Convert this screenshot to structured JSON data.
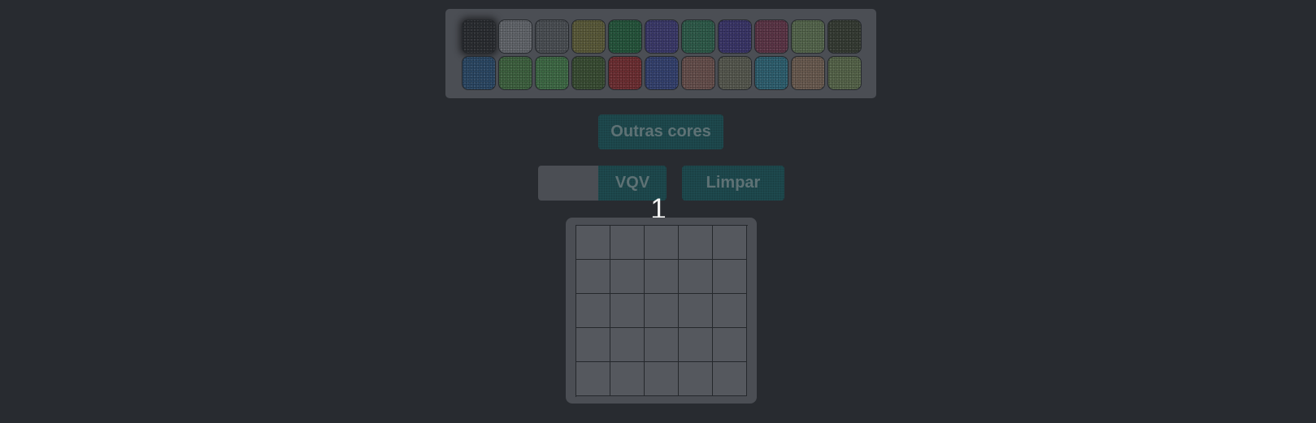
{
  "palette": {
    "rows": [
      [
        {
          "name": "swatch-black",
          "color": "#2a2d31",
          "selected": true
        },
        {
          "name": "swatch-light-gray",
          "color": "#63666c"
        },
        {
          "name": "swatch-gray",
          "color": "#4b4f54"
        },
        {
          "name": "swatch-olive",
          "color": "#5a5a3a"
        },
        {
          "name": "swatch-green",
          "color": "#25553c"
        },
        {
          "name": "swatch-purple",
          "color": "#3b3a6b"
        },
        {
          "name": "swatch-teal-green",
          "color": "#2e5b4a"
        },
        {
          "name": "swatch-indigo",
          "color": "#3a3568"
        },
        {
          "name": "swatch-plum",
          "color": "#5c3547"
        },
        {
          "name": "swatch-sage",
          "color": "#55664d"
        },
        {
          "name": "swatch-dark-moss",
          "color": "#353b33"
        }
      ],
      [
        {
          "name": "swatch-steel-blue",
          "color": "#2b4865"
        },
        {
          "name": "swatch-forest",
          "color": "#3e6240"
        },
        {
          "name": "swatch-leaf",
          "color": "#3e6a45"
        },
        {
          "name": "swatch-dark-green",
          "color": "#394d33"
        },
        {
          "name": "swatch-red",
          "color": "#6e2e32"
        },
        {
          "name": "swatch-navy",
          "color": "#34416f"
        },
        {
          "name": "swatch-brown",
          "color": "#674f4c"
        },
        {
          "name": "swatch-ash",
          "color": "#56584f"
        },
        {
          "name": "swatch-cyan",
          "color": "#2e6070"
        },
        {
          "name": "swatch-tan",
          "color": "#6a5b50"
        },
        {
          "name": "swatch-moss",
          "color": "#56654a"
        }
      ]
    ]
  },
  "controls": {
    "other_colors_label": "Outras cores",
    "vqv_label": "VQV",
    "clear_label": "Limpar"
  },
  "counter": "1",
  "board": {
    "rows": 5,
    "cols": 5,
    "cell_color": "#55585e"
  }
}
